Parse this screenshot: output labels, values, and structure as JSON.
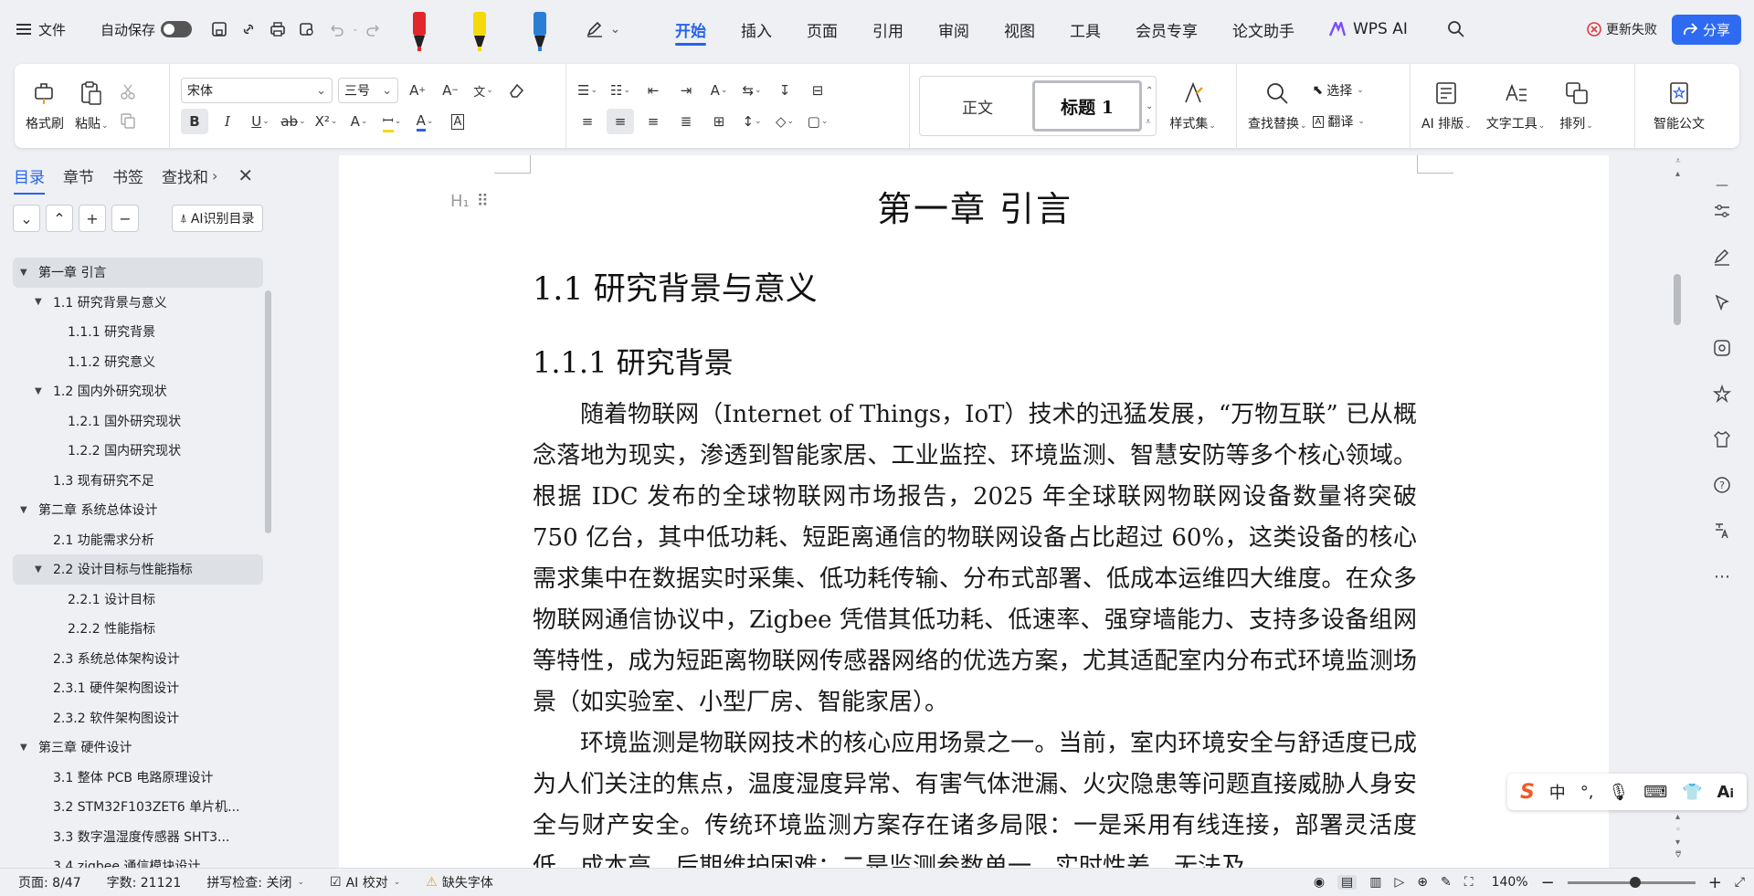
{
  "menubar": {
    "menu_label": "文件",
    "autosave_label": "自动保存",
    "tabs": [
      "开始",
      "插入",
      "页面",
      "引用",
      "审阅",
      "视图",
      "工具",
      "会员专享",
      "论文助手",
      "WPS AI"
    ],
    "update_failed": "更新失败",
    "share": "分享"
  },
  "ribbon": {
    "format_painter": "格式刷",
    "paste": "粘贴",
    "font_name": "宋体",
    "font_size": "三号",
    "style_normal": "正文",
    "style_heading1": "标题 1",
    "style_set": "样式集",
    "find_replace": "查找替换",
    "select": "选择",
    "translate": "翻译",
    "ai_layout": "AI 排版",
    "text_tools": "文字工具",
    "arrange": "排列",
    "smart_doc": "智能公文",
    "bold": "B",
    "italic": "I",
    "underline": "U",
    "strike": "ab",
    "superscript": "X²"
  },
  "nav": {
    "tabs": [
      "目录",
      "章节",
      "书签",
      "查找和"
    ],
    "ai_toc": "AI识别目录",
    "toc": [
      {
        "text": "第一章  引言",
        "level": 0,
        "expanded": true,
        "highlight": true
      },
      {
        "text": "1.1  研究背景与意义",
        "level": 1,
        "expanded": true,
        "highlight": false
      },
      {
        "text": "1.1.1  研究背景",
        "level": 2,
        "highlight": false
      },
      {
        "text": "1.1.2  研究意义",
        "level": 2,
        "highlight": false
      },
      {
        "text": "1.2  国内外研究现状",
        "level": 1,
        "expanded": true,
        "highlight": false
      },
      {
        "text": "1.2.1  国外研究现状",
        "level": 2,
        "highlight": false
      },
      {
        "text": "1.2.2  国内研究现状",
        "level": 2,
        "highlight": false
      },
      {
        "text": "1.3  现有研究不足",
        "level": 1,
        "highlight": false
      },
      {
        "text": "第二章  系统总体设计",
        "level": 0,
        "expanded": true,
        "highlight": false
      },
      {
        "text": "2.1  功能需求分析",
        "level": 1,
        "highlight": false
      },
      {
        "text": "2.2  设计目标与性能指标",
        "level": 1,
        "expanded": true,
        "highlight": true
      },
      {
        "text": "2.2.1 设计目标",
        "level": 2,
        "highlight": false
      },
      {
        "text": "2.2.2 性能指标",
        "level": 2,
        "highlight": false
      },
      {
        "text": "2.3  系统总体架构设计",
        "level": 1,
        "highlight": false
      },
      {
        "text": "2.3.1  硬件架构图设计",
        "level": 1,
        "highlight": false
      },
      {
        "text": "2.3.2  软件架构图设计",
        "level": 1,
        "highlight": false
      },
      {
        "text": "第三章  硬件设计",
        "level": 0,
        "expanded": true,
        "highlight": false
      },
      {
        "text": "3.1  整体 PCB 电路原理设计",
        "level": 1,
        "highlight": false
      },
      {
        "text": "3.2 STM32F103ZET6 单片机...",
        "level": 1,
        "highlight": false
      },
      {
        "text": "3.3  数字温湿度传感器 SHT3...",
        "level": 1,
        "highlight": false
      },
      {
        "text": "3.4 zigbee 通信模块设计",
        "level": 1,
        "highlight": false
      }
    ]
  },
  "doc": {
    "chapter_title": "第一章  引言",
    "h1": "1.1  研究背景与意义",
    "h2": "1.1.1  研究背景",
    "para1": "随着物联网（Internet of Things，IoT）技术的迅猛发展，“万物互联” 已从概念落地为现实，渗透到智能家居、工业监控、环境监测、智慧安防等多个核心领域。根据 IDC 发布的全球物联网市场报告，2025 年全球联网物联网设备数量将突破 750 亿台，其中低功耗、短距离通信的物联网设备占比超过 60%，这类设备的核心需求集中在数据实时采集、低功耗传输、分布式部署、低成本运维四大维度。在众多物联网通信协议中，Zigbee 凭借其低功耗、低速率、强穿墙能力、支持多设备组网等特性，成为短距离物联网传感器网络的优选方案，尤其适配室内分布式环境监测场景（如实验室、小型厂房、智能家居）。",
    "para2": "环境监测是物联网技术的核心应用场景之一。当前，室内环境安全与舒适度已成为人们关注的焦点，温度湿度异常、有害气体泄漏、火灾隐患等问题直接威胁人身安全与财产安全。传统环境监测方案存在诸多局限：一是采用有线连接，部署灵活度低、成本高、后期维护困难；二是监测参数单一，实时性差，无法及"
  },
  "ime": {
    "lang": "中"
  },
  "status": {
    "page": "页面: 8/47",
    "words": "字数: 21121",
    "spell": "拼写检查: 关闭",
    "ai_proof": "AI 校对",
    "missing_font": "缺失字体",
    "zoom": "140%"
  },
  "colors": {
    "accent": "#2563eb",
    "share_bg": "#2f6bf2",
    "highlight": "#dde0e5"
  }
}
